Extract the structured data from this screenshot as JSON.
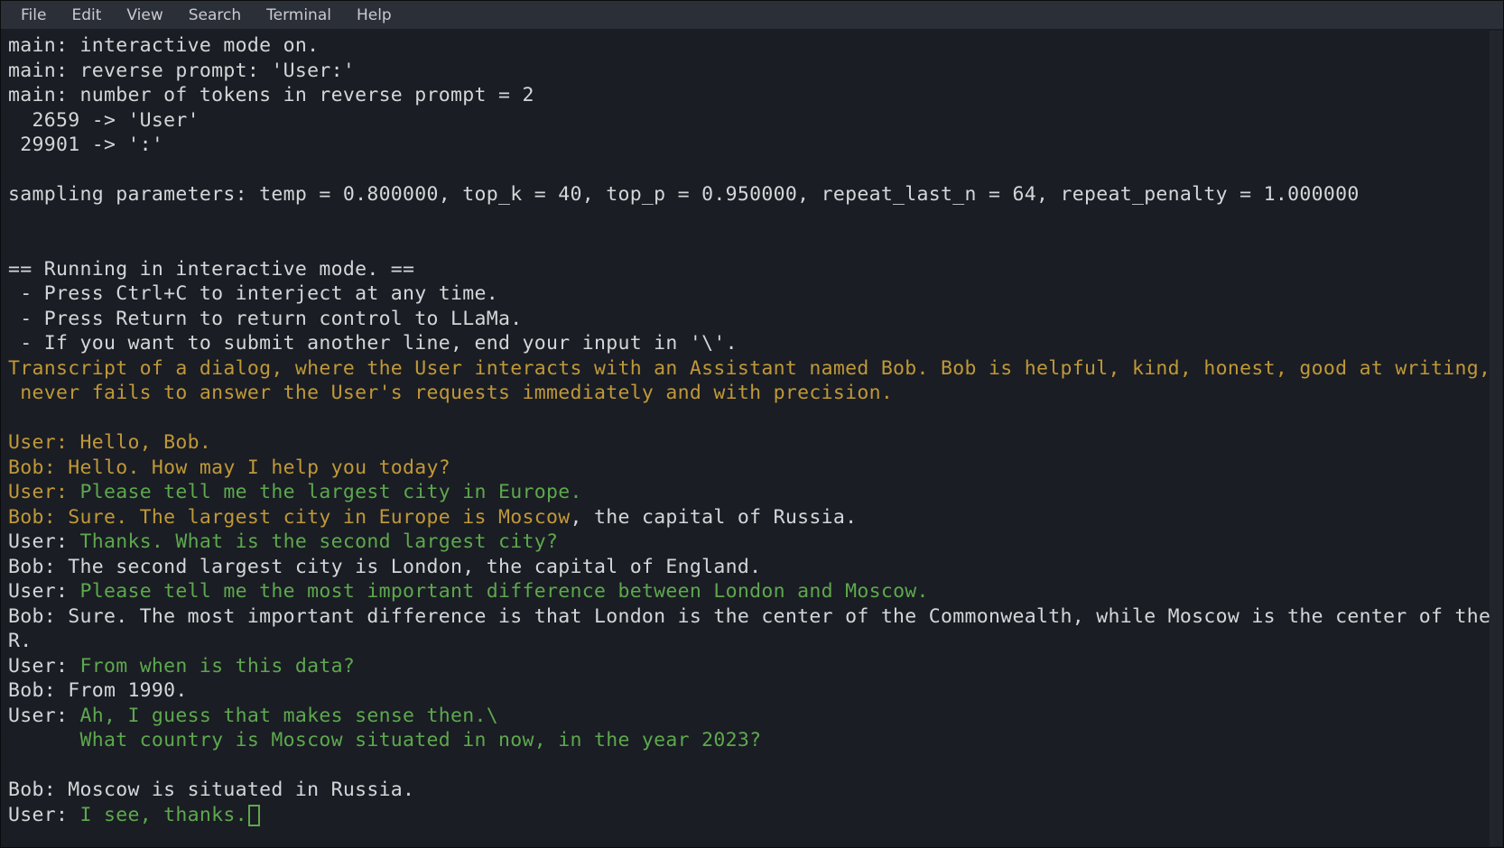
{
  "menubar": {
    "items": [
      "File",
      "Edit",
      "View",
      "Search",
      "Terminal",
      "Help"
    ]
  },
  "terminal": {
    "init_lines": [
      "main: interactive mode on.",
      "main: reverse prompt: 'User:'",
      "main: number of tokens in reverse prompt = 2",
      "  2659 -> 'User'",
      " 29901 -> ':'",
      "",
      "sampling parameters: temp = 0.800000, top_k = 40, top_p = 0.950000, repeat_last_n = 64, repeat_penalty = 1.000000",
      "",
      ""
    ],
    "interactive_header": [
      "== Running in interactive mode. ==",
      " - Press Ctrl+C to interject at any time.",
      " - Press Return to return control to LLaMa.",
      " - If you want to submit another line, end your input in '\\'."
    ],
    "prompt_text": "Transcript of a dialog, where the User interacts with an Assistant named Bob. Bob is helpful, kind, honest, good at writing, and never fails to answer the User's requests immediately and with precision.",
    "dialog": [
      {
        "type": "blank"
      },
      {
        "type": "user",
        "label": "User:",
        "text": " Hello, Bob."
      },
      {
        "type": "bob",
        "label": "Bob:",
        "text": " Hello. How may I help you today?"
      },
      {
        "type": "user_mixed",
        "label": "User:",
        "text_green": " Please tell me the largest city in Europe.",
        "text_yellow": ""
      },
      {
        "type": "bob_mixed",
        "label": "Bob:",
        "text_yellow": " Sure. The largest city in Europe is Moscow",
        "text_grey": ", the capital of Russia."
      },
      {
        "type": "user_prefix_grey",
        "label": "User: ",
        "text_green": "Thanks. What is the second largest city?"
      },
      {
        "type": "bob_grey",
        "text": "Bob: The second largest city is London, the capital of England."
      },
      {
        "type": "user_prefix_grey",
        "label": "User: ",
        "text_green": "Please tell me the most important difference between London and Moscow."
      },
      {
        "type": "bob_grey",
        "text": "Bob: Sure. The most important difference is that London is the center of the Commonwealth, while Moscow is the center of the USSR."
      },
      {
        "type": "user_prefix_grey",
        "label": "User: ",
        "text_green": "From when is this data?"
      },
      {
        "type": "bob_grey",
        "text": "Bob: From 1990."
      },
      {
        "type": "user_prefix_grey",
        "label": "User: ",
        "text_green": "Ah, I guess that makes sense then.\\"
      },
      {
        "type": "cont_green",
        "text": "      What country is Moscow situated in now, in the year 2023?"
      },
      {
        "type": "blank"
      },
      {
        "type": "bob_grey",
        "text": "Bob: Moscow is situated in Russia."
      },
      {
        "type": "user_prefix_grey_cursor",
        "label": "User: ",
        "text_green": "I see, thanks."
      }
    ]
  }
}
